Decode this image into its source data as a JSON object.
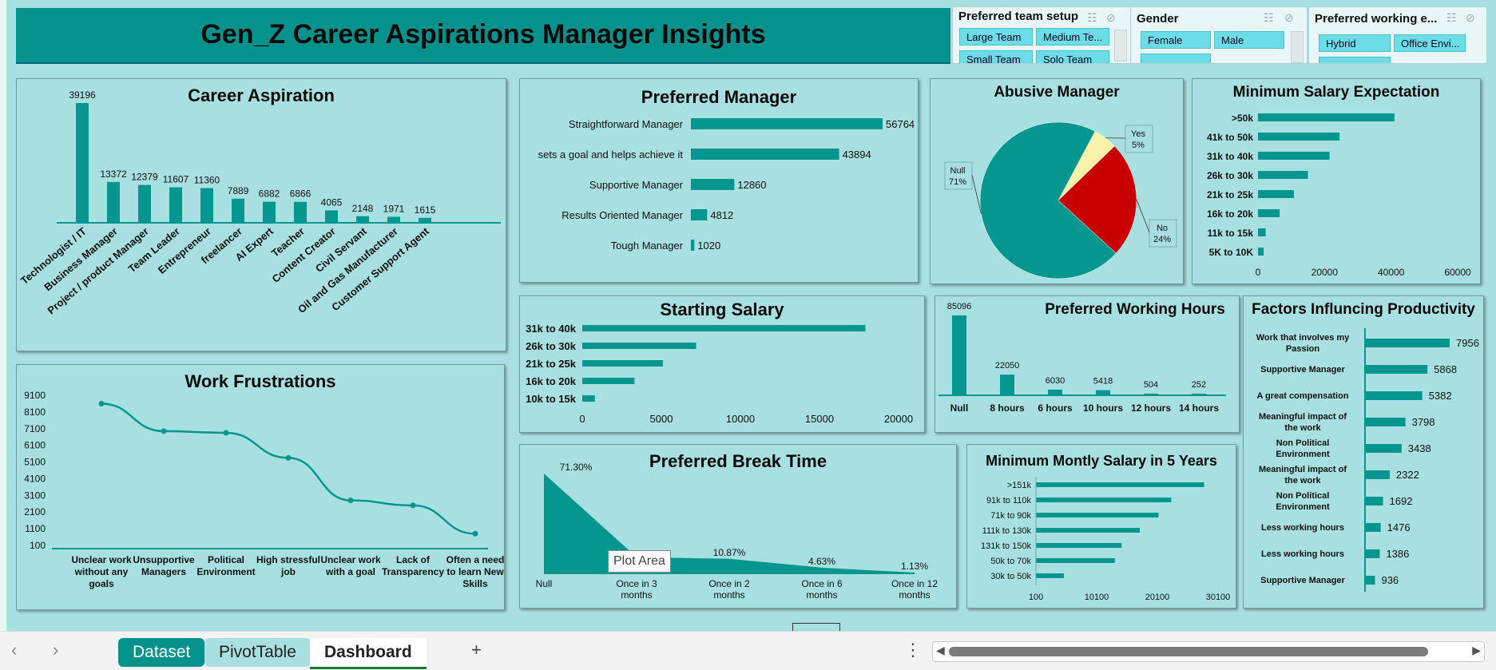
{
  "title": "Gen_Z Career Aspirations Manager Insights",
  "slicers": {
    "team": {
      "header": "Preferred team setup",
      "items": [
        "Large Team",
        "Medium Te...",
        "Small Team",
        "Solo Team"
      ]
    },
    "gender": {
      "header": "Gender",
      "items": [
        "Female",
        "Male"
      ]
    },
    "working_env": {
      "header": "Preferred working e...",
      "items": [
        "Hybrid",
        "Office Envi..."
      ]
    }
  },
  "charts": {
    "career": {
      "title": "Career Aspiration"
    },
    "manager": {
      "title": "Preferred Manager"
    },
    "abusive": {
      "title": "Abusive Manager"
    },
    "minsalary": {
      "title": "Minimum Salary Expectation"
    },
    "frustrations": {
      "title": "Work Frustrations"
    },
    "starting": {
      "title": "Starting Salary"
    },
    "hours": {
      "title": "Preferred Working  Hours"
    },
    "productivity": {
      "title": "Factors Influncing Productivity"
    },
    "breaktime": {
      "title": "Preferred Break Time",
      "tooltip": "Plot Area"
    },
    "salary5y": {
      "title": "Minimum Montly Salary in 5 Years"
    }
  },
  "chart_data": [
    {
      "id": "career",
      "type": "bar",
      "title": "Career Aspiration",
      "categories": [
        "Technologist / IT",
        "Business Manager",
        "Project / product Manager",
        "Team Leader",
        "Entrepreneur",
        "freelancer",
        "AI Expert",
        "Teacher",
        "Content Creator",
        "Civil Servant",
        "Oil and Gas Manufacturer",
        "Customer Support Agent"
      ],
      "values": [
        39196,
        13372,
        12379,
        11607,
        11360,
        7889,
        6882,
        6866,
        4065,
        2148,
        1971,
        1615
      ],
      "data_labels": true,
      "grid": false
    },
    {
      "id": "manager",
      "type": "bar",
      "orientation": "horizontal",
      "title": "Preferred Manager",
      "categories": [
        "Straightforward Manager",
        "sets a goal and helps achieve it",
        "Supportive Manager",
        "Results Oriented Manager",
        "Tough Manager"
      ],
      "values": [
        56764,
        43894,
        12860,
        4812,
        1020
      ],
      "data_labels": true
    },
    {
      "id": "abusive",
      "type": "pie",
      "title": "Abusive Manager",
      "categories": [
        "Null",
        "Yes",
        "No"
      ],
      "values": [
        71,
        5,
        24
      ],
      "labels": [
        "Null\n71%",
        "Yes\n5%",
        "No\n24%"
      ],
      "colors": [
        "#05968f",
        "#f8f2a8",
        "#c80000"
      ]
    },
    {
      "id": "minsalary",
      "type": "bar",
      "orientation": "horizontal",
      "title": "Minimum Salary Expectation",
      "categories": [
        ">50k",
        "41k to 50k",
        "31k to 40k",
        "26k to 30k",
        "21k to 25k",
        "16k to 20k",
        "11k to 15k",
        "5K to 10K"
      ],
      "values": [
        41000,
        24500,
        21500,
        15000,
        10800,
        6500,
        2300,
        1700
      ],
      "xlim": [
        0,
        60000
      ],
      "xticks": [
        "0",
        "20000",
        "40000",
        "60000"
      ]
    },
    {
      "id": "frustrations",
      "type": "line",
      "title": "Work Frustrations",
      "categories": [
        "Unclear work without any goals",
        "Unsupportive Managers",
        "Political Environment",
        "High stressful job",
        "Unclear work with a goal",
        "Lack of Transparency",
        "Often a need to learn New Skills"
      ],
      "values": [
        8600,
        6950,
        6850,
        5350,
        2800,
        2500,
        800
      ],
      "ylim": [
        100,
        9100
      ],
      "yticks": [
        "9100",
        "8100",
        "7100",
        "6100",
        "5100",
        "4100",
        "3100",
        "2100",
        "1100",
        "100"
      ]
    },
    {
      "id": "starting",
      "type": "bar",
      "orientation": "horizontal",
      "title": "Starting Salary",
      "categories": [
        "31k to 40k",
        "26k to 30k",
        "21k to 25k",
        "16k to 20k",
        "10k to 15k"
      ],
      "values": [
        17900,
        7200,
        5100,
        3300,
        800
      ],
      "xlim": [
        0,
        20000
      ],
      "xticks": [
        "0",
        "5000",
        "10000",
        "15000",
        "20000"
      ]
    },
    {
      "id": "hours",
      "type": "bar",
      "title": "Preferred Working  Hours",
      "categories": [
        "Null",
        "8 hours",
        "6 hours",
        "10 hours",
        "12 hours",
        "14 hours"
      ],
      "values": [
        85096,
        22050,
        6030,
        5418,
        504,
        252
      ],
      "data_labels": true
    },
    {
      "id": "productivity",
      "type": "bar",
      "orientation": "horizontal",
      "title": "Factors Influncing Productivity",
      "categories": [
        "Work that involves my Passion",
        "Supportive Manager",
        "A great compensation",
        "Meaningful impact of the work",
        "Non Political Environment",
        "Meaningful impact of the work",
        "Non Political Environment",
        "Less working hours",
        "Less working hours",
        "Supportive Manager"
      ],
      "values": [
        7956,
        5868,
        5382,
        3798,
        3438,
        2322,
        1692,
        1476,
        1386,
        936
      ],
      "data_labels": true
    },
    {
      "id": "breaktime",
      "type": "area",
      "title": "Preferred Break Time",
      "categories": [
        "Null",
        "Once in 3 months",
        "Once in 2 months",
        "Once in 6 months",
        "Once in 12 months"
      ],
      "values": [
        71.3,
        12.07,
        10.87,
        4.63,
        1.13
      ],
      "data_labels": [
        "71.30%",
        "",
        "10.87%",
        "4.63%",
        "1.13%"
      ]
    },
    {
      "id": "salary5y",
      "type": "bar",
      "orientation": "horizontal",
      "title": "Minimum Montly Salary in 5 Years",
      "categories": [
        ">151k",
        "91k to 110k",
        "71k to 90k",
        "111k to 130k",
        "131k to 150k",
        "50k to 70k",
        "30k to 50k"
      ],
      "values": [
        27800,
        22400,
        20300,
        17200,
        14200,
        13100,
        4700
      ],
      "xlim": [
        100,
        30100
      ],
      "xticks": [
        "100",
        "10100",
        "20100",
        "30100"
      ]
    }
  ],
  "tabs": [
    {
      "label": "Dataset",
      "active": false
    },
    {
      "label": "PivotTable",
      "active": false
    },
    {
      "label": "Dashboard",
      "active": true
    }
  ],
  "nav": {
    "prev": "‹",
    "next": "›",
    "add": "+",
    "more": "⋮"
  },
  "colors": {
    "teal": "#05968f",
    "background": "#a8dfe0",
    "red": "#c80000",
    "yellow": "#f8f2a8"
  }
}
